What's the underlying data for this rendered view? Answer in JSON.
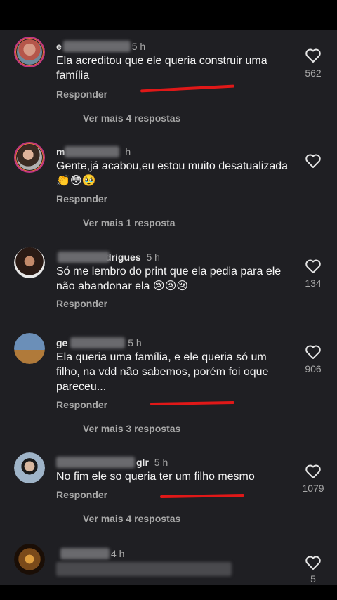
{
  "comments": [
    {
      "username": "e",
      "time": "5 h",
      "text": "Ela acreditou que ele queria construir uma família",
      "reply": "Responder",
      "more": "Ver mais 4 respostas",
      "likes": "562",
      "avatar_color": "#b5564a"
    },
    {
      "username": "m",
      "time": "h",
      "text": "Gente,já acabou,eu estou muito desatualizada 👏😳🥹",
      "reply": "Responder",
      "more": "Ver mais 1 resposta",
      "likes": "",
      "avatar_color": "#8a6a55"
    },
    {
      "username": "drigues",
      "time": "5 h",
      "text": "Só me lembro do print que ela pedia para ele não abandonar ela 😢😢😢",
      "reply": "Responder",
      "more": "",
      "likes": "134",
      "avatar_color": "#5a3a2e"
    },
    {
      "username": "ge",
      "time": "5 h",
      "text": "Ela queria uma família, e ele queria só um filho, na vdd não sabemos, porém foi oque pareceu...",
      "reply": "Responder",
      "more": "Ver mais 3 respostas",
      "likes": "906",
      "avatar_color": "#6b8fb8"
    },
    {
      "username": "glr",
      "time": "5 h",
      "text": "No fim ele so queria ter um filho mesmo",
      "reply": "Responder",
      "more": "Ver mais 4 respostas",
      "likes": "1079",
      "avatar_color": "#9fb4c8"
    },
    {
      "username": "",
      "time": "4 h",
      "text": "",
      "reply": "",
      "more": "",
      "likes": "5",
      "avatar_color": "#7a4a1a"
    }
  ]
}
